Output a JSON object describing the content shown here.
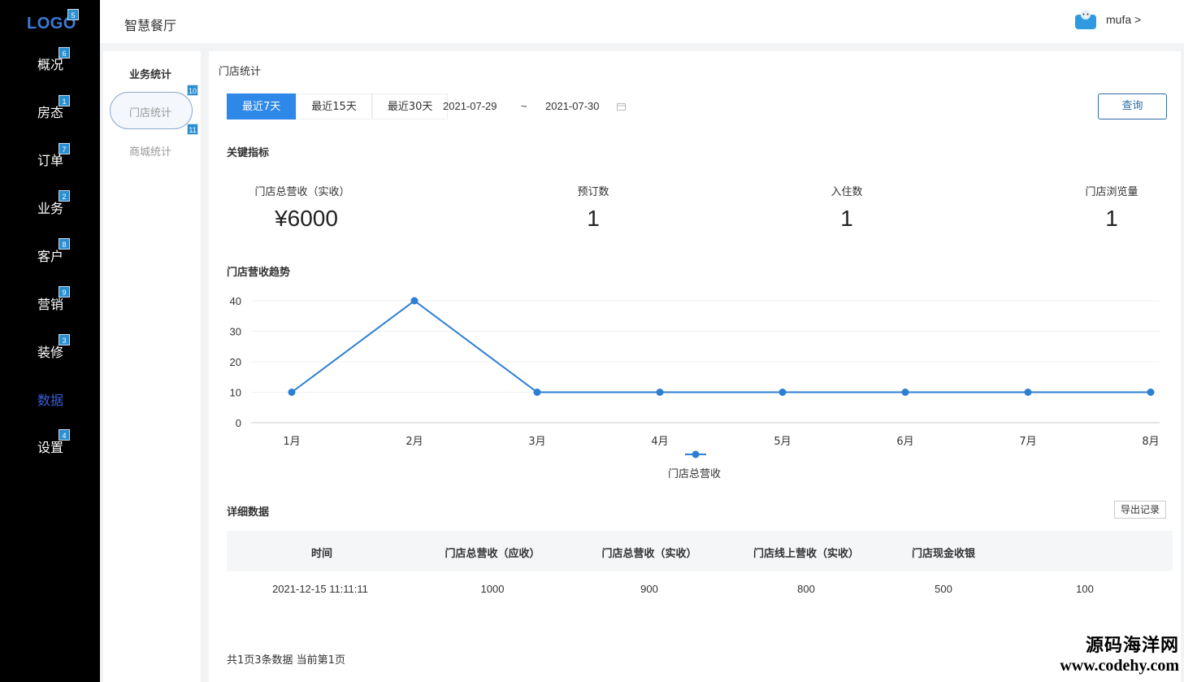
{
  "sidebar": {
    "logo": "LOGO",
    "logo_badge": "5",
    "items": [
      {
        "label": "概况",
        "badge": "6"
      },
      {
        "label": "房态",
        "badge": "1"
      },
      {
        "label": "订单",
        "badge": "7"
      },
      {
        "label": "业务",
        "badge": "2"
      },
      {
        "label": "客户",
        "badge": "8"
      },
      {
        "label": "营销",
        "badge": "9"
      },
      {
        "label": "装修",
        "badge": "3"
      },
      {
        "label": "数据",
        "badge": ""
      },
      {
        "label": "设置",
        "badge": "4"
      }
    ],
    "active_index": 7
  },
  "header": {
    "app_title": "智慧餐厅",
    "user": "mufa >"
  },
  "subnav": {
    "title": "业务统计",
    "items": [
      {
        "label": "门店统计",
        "badge": "10"
      },
      {
        "label": "商城统计",
        "badge": "11"
      }
    ]
  },
  "main": {
    "title": "门店统计",
    "ranges": [
      "最近7天",
      "最近15天",
      "最近30天"
    ],
    "date_from": "2021-07-29",
    "date_sep": "~",
    "date_to": "2021-07-30",
    "query_label": "查询",
    "kpi_section": "关键指标",
    "kpis": [
      {
        "label": "门店总营收（实收）",
        "value": "¥6000"
      },
      {
        "label": "预订数",
        "value": "1"
      },
      {
        "label": "入住数",
        "value": "1"
      },
      {
        "label": "门店浏览量",
        "value": "1"
      }
    ],
    "trend_section": "门店营收趋势",
    "detail_section": "详细数据",
    "export_label": "导出记录",
    "table": {
      "headers": [
        "时间",
        "门店总营收（应收）",
        "门店总营收（实收）",
        "门店线上营收（实收）",
        "门店现金收银",
        ""
      ],
      "rows": [
        [
          "2021-12-15 11:11:11",
          "1000",
          "900",
          "800",
          "500",
          "100"
        ]
      ]
    },
    "pager": "共1页3条数据 当前第1页"
  },
  "chart_data": {
    "type": "line",
    "categories": [
      "1月",
      "2月",
      "3月",
      "4月",
      "5月",
      "6月",
      "7月",
      "8月"
    ],
    "series": [
      {
        "name": "门店总营收",
        "values": [
          10,
          40,
          10,
          10,
          10,
          10,
          10,
          10
        ]
      }
    ],
    "yticks": [
      0,
      10,
      20,
      30,
      40
    ],
    "ylim": [
      0,
      40
    ],
    "color": "#2d7fd3",
    "grid": true,
    "legend": "bottom"
  },
  "watermark": {
    "line1": "源码海洋网",
    "line2": "www.codehy.com"
  }
}
